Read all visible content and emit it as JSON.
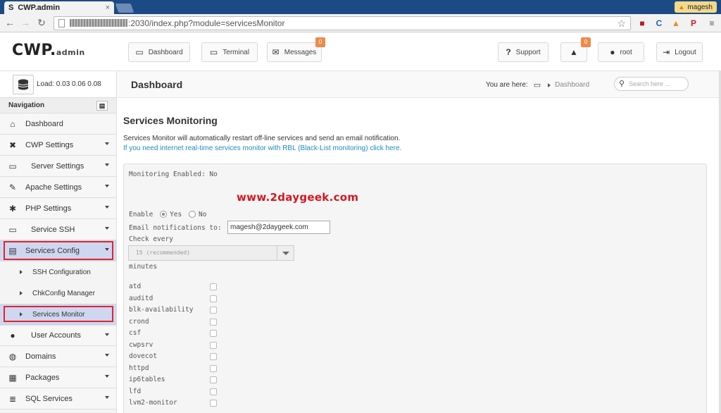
{
  "browser": {
    "tab_favicon": "S",
    "tab_title": "CWP.admin",
    "tab_close": "×",
    "user": "magesh",
    "url": ":2030/index.php?module=servicesMonitor"
  },
  "header": {
    "logo_main": "CWP.",
    "logo_sub": "admin",
    "dashboard_label": "Dashboard",
    "terminal_label": "Terminal",
    "messages_label": "Messages",
    "messages_badge": "0",
    "support_label": "Support",
    "notifications_badge": "0",
    "user_label": "root",
    "logout_label": "Logout"
  },
  "sidebar": {
    "load_label": "Load: 0.03  0.06  0.08",
    "nav_heading": "Navigation",
    "items": [
      {
        "label": "Dashboard",
        "icon": "home-icon"
      },
      {
        "label": "CWP Settings",
        "icon": "tools-icon"
      },
      {
        "label": "Server Settings",
        "icon": "server-icon"
      },
      {
        "label": "Apache Settings",
        "icon": "feather-icon"
      },
      {
        "label": "PHP Settings",
        "icon": "gear-icon"
      },
      {
        "label": "Service SSH",
        "icon": "monitor-icon"
      },
      {
        "label": "Services Config",
        "icon": "drive-icon"
      },
      {
        "label": "User Accounts",
        "icon": "user-icon"
      },
      {
        "label": "Domains",
        "icon": "globe-icon"
      },
      {
        "label": "Packages",
        "icon": "boxes-icon"
      },
      {
        "label": "SQL Services",
        "icon": "database-icon"
      }
    ],
    "subitems": [
      {
        "label": "SSH Configuration"
      },
      {
        "label": "ChkConfig Manager"
      },
      {
        "label": "Services Monitor"
      }
    ]
  },
  "main": {
    "page_title": "Dashboard",
    "breadcrumb_prefix": "You are here:",
    "breadcrumb_current": "Dashboard",
    "search_placeholder": "Search here ...",
    "section_title": "Services Monitoring",
    "description": "Services Monitor will automatically restart off-line services and send an email notification.",
    "rbl_link": "If you need internet real-time services monitor with RBL (Black-List monitoring) click here.",
    "monitoring_enabled": "Monitoring Enabled: No",
    "watermark": "www.2daygeek.com",
    "enable_label": "Enable",
    "enable_yes": "Yes",
    "enable_no": "No",
    "email_label": "Email notifications to:",
    "email_value": "magesh@2daygeek.com",
    "check_every_label": "Check every",
    "check_every_value": "15 (recommended)",
    "minutes_label": "minutes",
    "services": [
      "atd",
      "auditd",
      "blk-availability",
      "crond",
      "csf",
      "cwpsrv",
      "dovecot",
      "httpd",
      "ip6tables",
      "lfd",
      "lvm2-monitor"
    ]
  }
}
